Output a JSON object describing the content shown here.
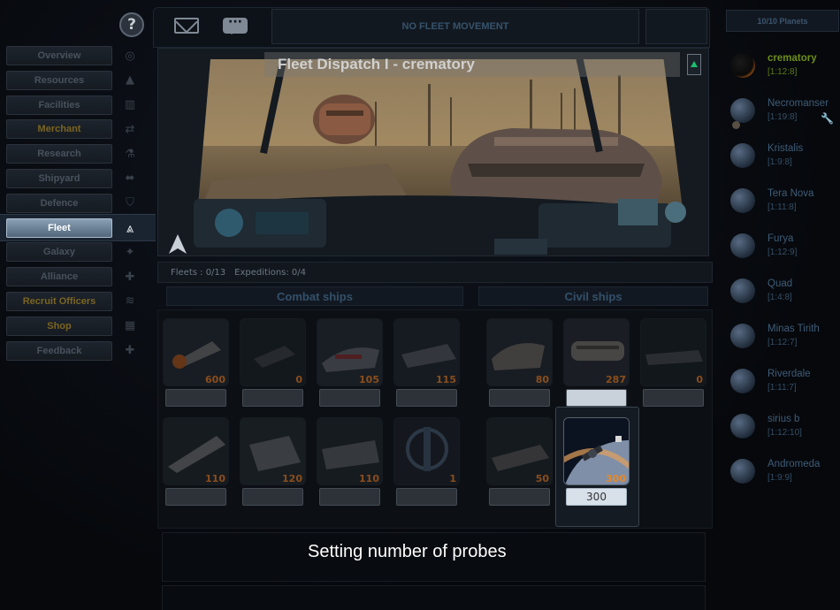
{
  "help": {
    "label": "?"
  },
  "menu": {
    "items": [
      {
        "label": "Overview",
        "color": "normal",
        "icon": "globe-icon",
        "glyph": "◎"
      },
      {
        "label": "Resources",
        "color": "normal",
        "icon": "mine-icon",
        "glyph": "▲"
      },
      {
        "label": "Facilities",
        "color": "normal",
        "icon": "factory-icon",
        "glyph": "▥"
      },
      {
        "label": "Merchant",
        "color": "gold",
        "icon": "trade-icon",
        "glyph": "⇄"
      },
      {
        "label": "Research",
        "color": "normal",
        "icon": "flask-icon",
        "glyph": "⚗"
      },
      {
        "label": "Shipyard",
        "color": "normal",
        "icon": "shipyard-icon",
        "glyph": "⬌"
      },
      {
        "label": "Defence",
        "color": "normal",
        "icon": "shield-icon",
        "glyph": "⛉"
      },
      {
        "label": "Fleet",
        "color": "active",
        "icon": "fleet-icon",
        "glyph": "⩓"
      },
      {
        "label": "Galaxy",
        "color": "normal",
        "icon": "galaxy-icon",
        "glyph": "✦"
      },
      {
        "label": "Alliance",
        "color": "normal",
        "icon": "alliance-icon",
        "glyph": "✚"
      },
      {
        "label": "Recruit Officers",
        "color": "gold",
        "icon": "officers-icon",
        "glyph": "≋"
      },
      {
        "label": "Shop",
        "color": "gold",
        "icon": "shop-icon",
        "glyph": "▦"
      },
      {
        "label": "Feedback",
        "color": "normal",
        "icon": "feedback-icon",
        "glyph": "✚"
      }
    ]
  },
  "topbar": {
    "messages_icon": "envelope-icon",
    "chat_icon": "chat-bubble-icon",
    "chat_glyph": "···",
    "fleet_movement": "NO FLEET MOVEMENT"
  },
  "hero": {
    "title": "Fleet Dispatch I - crematory"
  },
  "fleet_info": {
    "fleets": "Fleets : 0/13",
    "expeditions": "Expeditions: 0/4"
  },
  "sections": {
    "combat": "Combat ships",
    "civil": "Civil ships"
  },
  "ships": {
    "combat": [
      {
        "count": "600",
        "input": ""
      },
      {
        "count": "0",
        "input": ""
      },
      {
        "count": "105",
        "input": ""
      },
      {
        "count": "115",
        "input": ""
      },
      {
        "count": "110",
        "input": ""
      },
      {
        "count": "120",
        "input": ""
      },
      {
        "count": "110",
        "input": ""
      },
      {
        "count": "1",
        "input": ""
      }
    ],
    "civil": [
      {
        "count": "80",
        "input": ""
      },
      {
        "count": "287",
        "input": ""
      },
      {
        "count": "0",
        "input": ""
      },
      {
        "count": "50",
        "input": ""
      },
      {
        "count": "300",
        "input": "300"
      }
    ]
  },
  "caption": "Setting number of probes",
  "planets": {
    "header": "10/10 Planets",
    "list": [
      {
        "name": "crematory",
        "coords": "[1:12:8]"
      },
      {
        "name": "Necromanser",
        "coords": "[1:19:8]"
      },
      {
        "name": "Kristalis",
        "coords": "[1:9:8]"
      },
      {
        "name": "Tera Nova",
        "coords": "[1:11:8]"
      },
      {
        "name": "Furya",
        "coords": "[1:12:9]"
      },
      {
        "name": "Quad",
        "coords": "[1:4:8]"
      },
      {
        "name": "Minas Tirith",
        "coords": "[1:12:7]"
      },
      {
        "name": "Riverdale",
        "coords": "[1:11:7]"
      },
      {
        "name": "sirius b",
        "coords": "[1:12:10]"
      },
      {
        "name": "Andromeda",
        "coords": "[1:9:9]"
      }
    ]
  },
  "colors": {
    "accent_orange": "#e78a2a",
    "current_planet": "#6e8e1b",
    "active_menu": "#8aa0b5"
  }
}
